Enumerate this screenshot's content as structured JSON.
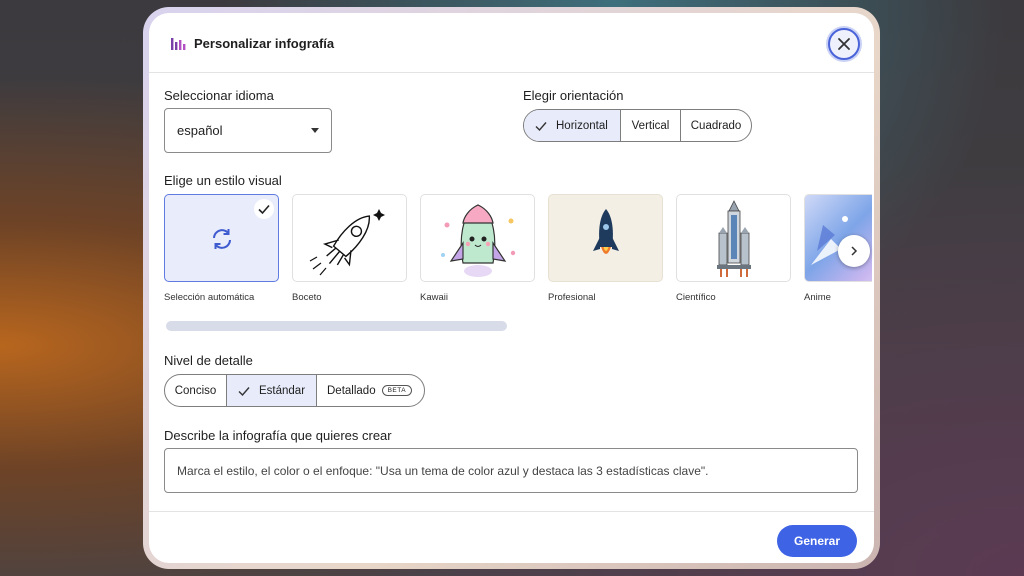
{
  "dialog": {
    "title": "Personalizar infografía",
    "close_icon": "close-icon",
    "app_icon": "chart-bars-icon"
  },
  "language": {
    "label": "Seleccionar idioma",
    "value": "español"
  },
  "orientation": {
    "label": "Elegir orientación",
    "options": [
      "Horizontal",
      "Vertical",
      "Cuadrado"
    ],
    "selected": "Horizontal"
  },
  "style": {
    "label": "Elige un estilo visual",
    "items": [
      {
        "label": "Selección automática",
        "icon": "sync-icon",
        "selected": true
      },
      {
        "label": "Boceto",
        "icon": "sketch-rocket"
      },
      {
        "label": "Kawaii",
        "icon": "kawaii-rocket"
      },
      {
        "label": "Profesional",
        "icon": "professional-rocket"
      },
      {
        "label": "Científico",
        "icon": "scientific-rocket"
      },
      {
        "label": "Anime",
        "icon": "anime-rocket"
      }
    ]
  },
  "detail": {
    "label": "Nivel de detalle",
    "options": [
      "Conciso",
      "Estándar",
      "Detallado"
    ],
    "selected": "Estándar",
    "beta_badge": "BETA"
  },
  "description": {
    "label": "Describe la infografía que quieres crear",
    "placeholder": "Marca el estilo, el color o el enfoque: \"Usa un tema de color azul y destaca las 3 estadísticas clave\"."
  },
  "footer": {
    "generate_label": "Generar"
  },
  "colors": {
    "accent": "#3f63e5",
    "selected_bg": "#e7ebfa"
  }
}
